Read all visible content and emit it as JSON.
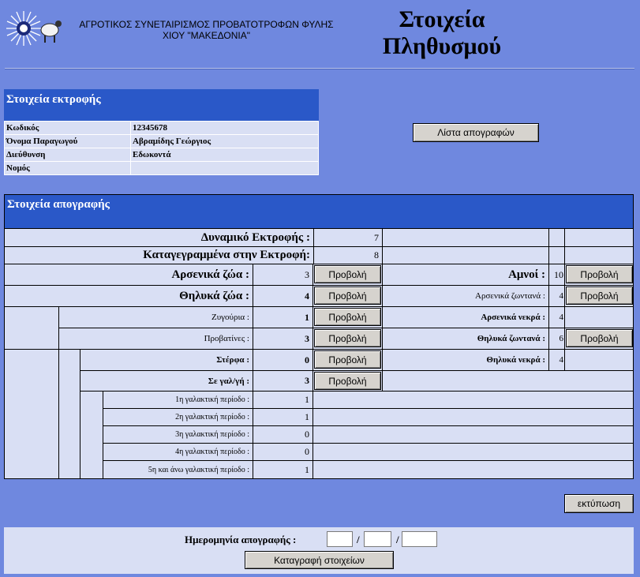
{
  "header": {
    "org_line1": "ΑΓΡΟΤΙΚΟΣ ΣΥΝΕΤΑΙΡΙΣΜΟΣ ΠΡΟΒΑΤΟΤΡΟΦΩΝ ΦΥΛΗΣ",
    "org_line2": "ΧΙΟΥ \"ΜΑΚΕΔΟΝΙΑ\"",
    "title_line1": "Στοιχεία",
    "title_line2": "Πληθυσμού"
  },
  "farm": {
    "heading": "Στοιχεία εκτροφής",
    "rows": [
      {
        "label": "Κωδικός",
        "value": "12345678"
      },
      {
        "label": "Όνομα Παραγωγού",
        "value": "Αβραμίδης Γεώργιος"
      },
      {
        "label": "Διεύθυνση",
        "value": "Εδωκοντά"
      },
      {
        "label": "Νομός",
        "value": ""
      }
    ]
  },
  "list_button": "Λίστα απογραφών",
  "census": {
    "heading": "Στοιχεία απογραφής",
    "view_label": "Προβολή",
    "capacity_label": "Δυναμικό Εκτροφής :",
    "capacity_value": "7",
    "registered_label": "Καταγεγραμμένα στην Εκτροφή:",
    "registered_value": "8",
    "male_label": "Αρσενικά ζώα :",
    "male_value": "3",
    "female_label": "Θηλυκά ζώα :",
    "female_value": "4",
    "rams_label": "Ζυγούρια :",
    "rams_value": "1",
    "ewes_label": "Προβατίνες :",
    "ewes_value": "3",
    "dry_label": "Στέρφα :",
    "dry_value": "0",
    "milking_label": "Σε γαλ/γή :",
    "milking_value": "3",
    "lactations": [
      {
        "label": "1η γαλακτική περίοδο :",
        "value": "1"
      },
      {
        "label": "2η γαλακτική περίοδο :",
        "value": "1"
      },
      {
        "label": "3η γαλακτική περίοδο :",
        "value": "0"
      },
      {
        "label": "4η γαλακτική περίοδο :",
        "value": "0"
      },
      {
        "label": "5η και άνω γαλακτική περίοδο :",
        "value": "1"
      }
    ],
    "lambs_label": "Αμνοί :",
    "lambs_value": "10",
    "male_alive_label": "Αρσενικά ζωντανά :",
    "male_alive_value": "4",
    "male_dead_label": "Αρσενικά νεκρά :",
    "male_dead_value": "4",
    "female_alive_label": "Θηλυκά ζωντανά :",
    "female_alive_value": "6",
    "female_dead_label": "Θηλυκά νεκρά :",
    "female_dead_value": "4"
  },
  "print_button": "εκτύπωση",
  "bottom": {
    "date_label": "Ημερομηνία απογραφής :",
    "separator": "/",
    "day": "",
    "month": "",
    "year": "",
    "save_button": "Καταγραφή στοιχείων"
  },
  "icons": {
    "logo": "sun-sheep-logo-icon"
  },
  "colors": {
    "background": "#6f88df",
    "section_header": "#2a58c8",
    "cell": "#d9dff4"
  }
}
